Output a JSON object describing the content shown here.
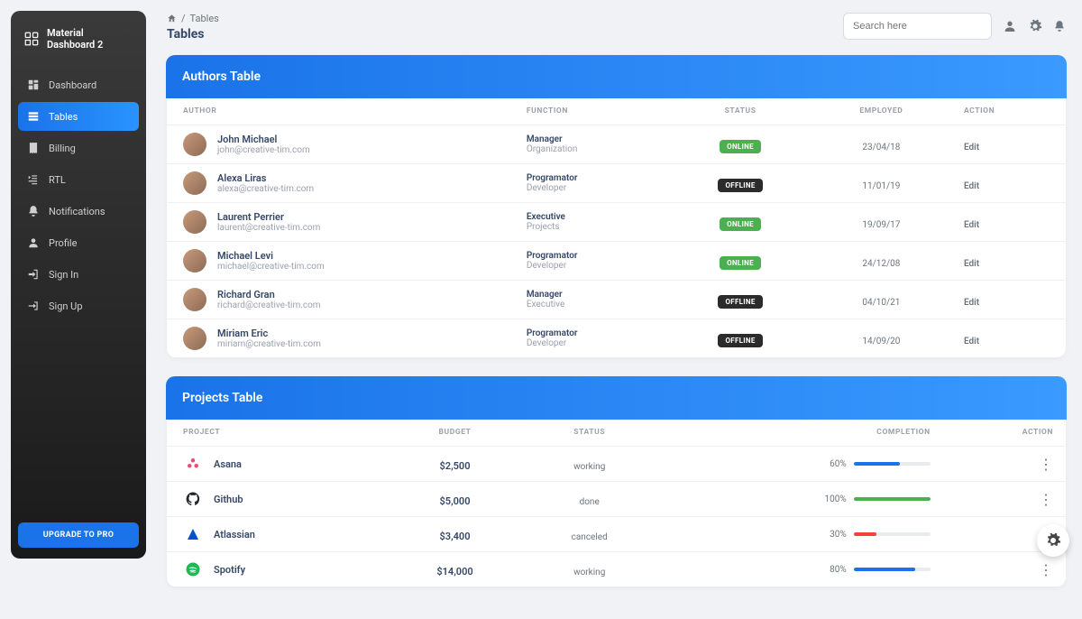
{
  "brand": "Material Dashboard 2",
  "sidebar": {
    "items": [
      {
        "label": "Dashboard",
        "icon": "dashboard"
      },
      {
        "label": "Tables",
        "icon": "table"
      },
      {
        "label": "Billing",
        "icon": "receipt"
      },
      {
        "label": "RTL",
        "icon": "rtl"
      },
      {
        "label": "Notifications",
        "icon": "bell"
      },
      {
        "label": "Profile",
        "icon": "person"
      },
      {
        "label": "Sign In",
        "icon": "login"
      },
      {
        "label": "Sign Up",
        "icon": "signup"
      }
    ],
    "upgrade_label": "UPGRADE TO PRO"
  },
  "search_placeholder": "Search here",
  "breadcrumb": {
    "root": "Tables",
    "title": "Tables"
  },
  "authors": {
    "title": "Authors Table",
    "headers": [
      "AUTHOR",
      "FUNCTION",
      "STATUS",
      "EMPLOYED",
      "ACTION"
    ],
    "action_label": "Edit",
    "rows": [
      {
        "name": "John Michael",
        "email": "john@creative-tim.com",
        "role": "Manager",
        "dept": "Organization",
        "status": "ONLINE",
        "date": "23/04/18"
      },
      {
        "name": "Alexa Liras",
        "email": "alexa@creative-tim.com",
        "role": "Programator",
        "dept": "Developer",
        "status": "OFFLINE",
        "date": "11/01/19"
      },
      {
        "name": "Laurent Perrier",
        "email": "laurent@creative-tim.com",
        "role": "Executive",
        "dept": "Projects",
        "status": "ONLINE",
        "date": "19/09/17"
      },
      {
        "name": "Michael Levi",
        "email": "michael@creative-tim.com",
        "role": "Programator",
        "dept": "Developer",
        "status": "ONLINE",
        "date": "24/12/08"
      },
      {
        "name": "Richard Gran",
        "email": "richard@creative-tim.com",
        "role": "Manager",
        "dept": "Executive",
        "status": "OFFLINE",
        "date": "04/10/21"
      },
      {
        "name": "Miriam Eric",
        "email": "miriam@creative-tim.com",
        "role": "Programator",
        "dept": "Developer",
        "status": "OFFLINE",
        "date": "14/09/20"
      }
    ]
  },
  "projects": {
    "title": "Projects Table",
    "headers": [
      "PROJECT",
      "BUDGET",
      "STATUS",
      "COMPLETION",
      "ACTION"
    ],
    "rows": [
      {
        "name": "Asana",
        "budget": "$2,500",
        "status": "working",
        "pct": 60,
        "color": "#1a73e8",
        "icon_color": "#e94e77"
      },
      {
        "name": "Github",
        "budget": "$5,000",
        "status": "done",
        "pct": 100,
        "color": "#4caf50",
        "icon_color": "#24292e"
      },
      {
        "name": "Atlassian",
        "budget": "$3,400",
        "status": "canceled",
        "pct": 30,
        "color": "#f44336",
        "icon_color": "#0052cc"
      },
      {
        "name": "Spotify",
        "budget": "$14,000",
        "status": "working",
        "pct": 80,
        "color": "#1a73e8",
        "icon_color": "#1db954"
      }
    ]
  }
}
